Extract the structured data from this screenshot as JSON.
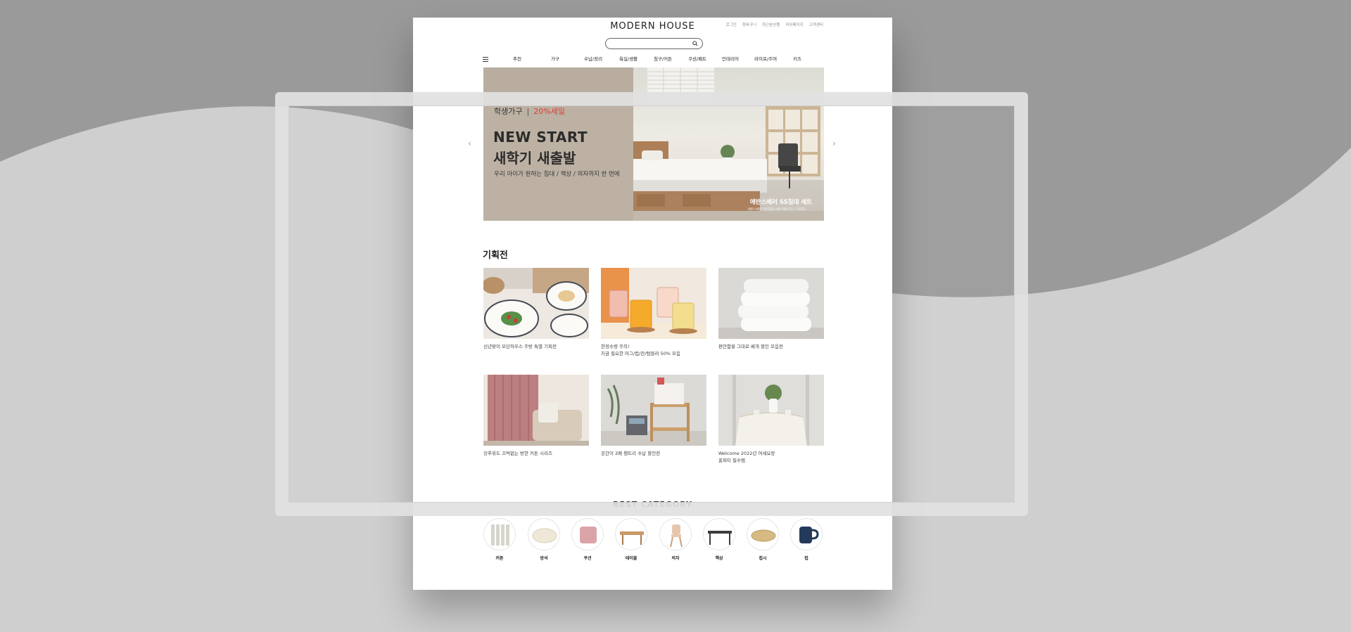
{
  "header": {
    "logo": "MODERN HOUSE",
    "util_links": [
      "로그인",
      "장바구니",
      "최근본상품",
      "마이페이지",
      "고객센터"
    ],
    "search_placeholder": ""
  },
  "nav": {
    "items": [
      "추천",
      "가구",
      "수납/정리",
      "욕실/생활",
      "침구/커튼",
      "쿠션/패트",
      "인테리어",
      "라이프/주머",
      "키즈"
    ]
  },
  "banner": {
    "category": "학생가구",
    "divider": "|",
    "sale": "20%세일",
    "headline_1": "NEW START",
    "headline_2": "새학기 새출발",
    "description": "우리 아이가 원하는 침대 / 책상 / 의자까지 한 번에",
    "product_name": "에반스베러 SS침대 세트",
    "product_sub": "에반스베러 원목침대 세트(매트리스 미포함)"
  },
  "exhibition": {
    "title": "기획전",
    "cards": [
      {
        "caption": "신년맞이 모던하우스 주방 특별 기획전"
      },
      {
        "caption": "한정수량 주의!\n지금 필요한 머그/컵/잔/텀블러 50% 모음"
      },
      {
        "caption": "편안함을 그대로 베개 할인 모음전"
      },
      {
        "caption": "강추위도 끄떡없는 방한 커튼 시리즈"
      },
      {
        "caption": "공간이 2배 팬트리 수납 할인전"
      },
      {
        "caption": "Welcome 2022년 여세요망\n홈파티 필수템"
      }
    ]
  },
  "best_category": {
    "title": "BEST CATEGORY",
    "items": [
      "커튼",
      "방석",
      "쿠션",
      "테이블",
      "의자",
      "책상",
      "접시",
      "컵"
    ]
  },
  "colors": {
    "sale_red": "#d9332b",
    "banner_beige": "#b8ad9e",
    "background_gray": "#cdcdcd"
  }
}
